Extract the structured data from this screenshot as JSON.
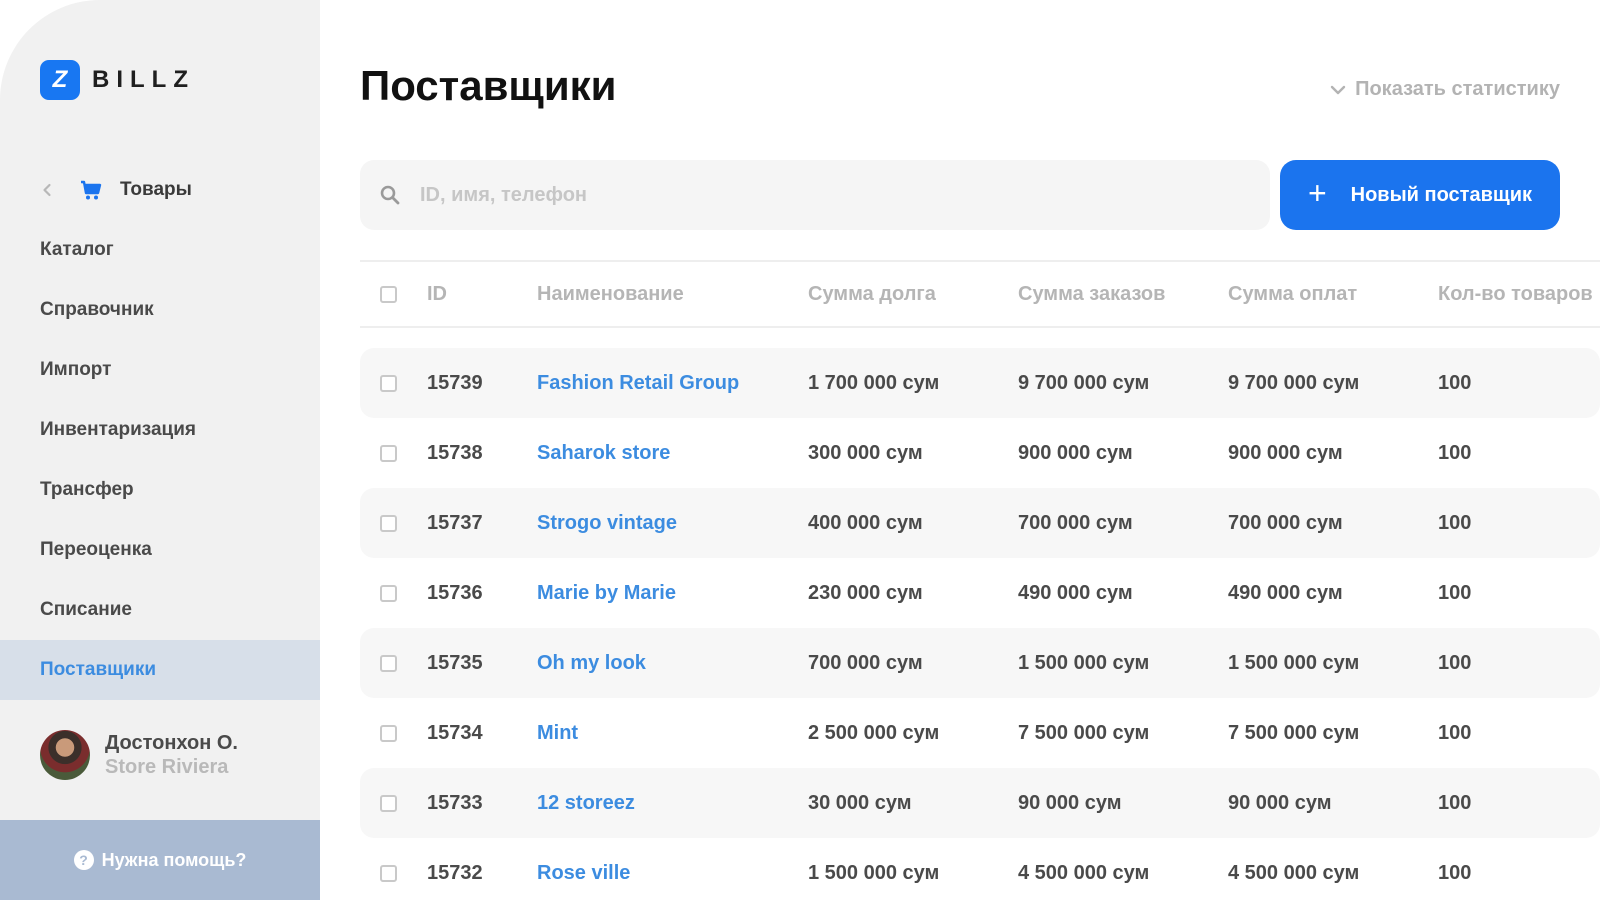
{
  "brand": {
    "mark": "Z",
    "name": "BILLZ"
  },
  "sidebar": {
    "back_item": {
      "label": "Товары"
    },
    "items": [
      {
        "label": "Каталог",
        "active": false
      },
      {
        "label": "Справочник",
        "active": false
      },
      {
        "label": "Импорт",
        "active": false
      },
      {
        "label": "Инвентаризация",
        "active": false
      },
      {
        "label": "Трансфер",
        "active": false
      },
      {
        "label": "Переоценка",
        "active": false
      },
      {
        "label": "Списание",
        "active": false
      },
      {
        "label": "Поставщики",
        "active": true
      }
    ],
    "user": {
      "name": "Достонхон О.",
      "store": "Store Riviera"
    },
    "help_label": "Нужна помощь?"
  },
  "header": {
    "title": "Поставщики",
    "stats_toggle": "Показать статистику"
  },
  "search": {
    "placeholder": "ID, имя, телефон",
    "value": ""
  },
  "new_button": {
    "label": "Новый поставщик"
  },
  "table": {
    "columns": [
      "ID",
      "Наименование",
      "Сумма долга",
      "Сумма заказов",
      "Сумма оплат",
      "Кол-во товаров"
    ],
    "rows": [
      {
        "id": "15739",
        "name": "Fashion Retail Group",
        "debt": "1 700 000 сум",
        "orders": "9 700 000 сум",
        "payments": "9 700 000 сум",
        "qty": "100"
      },
      {
        "id": "15738",
        "name": "Saharok store",
        "debt": "300 000 сум",
        "orders": "900 000 сум",
        "payments": "900 000 сум",
        "qty": "100"
      },
      {
        "id": "15737",
        "name": "Strogo vintage",
        "debt": "400 000 сум",
        "orders": "700 000 сум",
        "payments": "700 000 сум",
        "qty": "100"
      },
      {
        "id": "15736",
        "name": "Marie by Marie",
        "debt": "230 000 сум",
        "orders": "490 000 сум",
        "payments": "490 000 сум",
        "qty": "100"
      },
      {
        "id": "15735",
        "name": "Oh my look",
        "debt": "700 000 сум",
        "orders": "1 500 000 сум",
        "payments": "1 500 000 сум",
        "qty": "100"
      },
      {
        "id": "15734",
        "name": "Mint",
        "debt": "2 500 000 сум",
        "orders": "7 500 000 сум",
        "payments": "7 500 000 сум",
        "qty": "100"
      },
      {
        "id": "15733",
        "name": "12 storeez",
        "debt": "30 000 сум",
        "orders": "90 000 сум",
        "payments": "90 000 сум",
        "qty": "100"
      },
      {
        "id": "15732",
        "name": "Rose ville",
        "debt": "1 500 000 сум",
        "orders": "4 500 000 сум",
        "payments": "4 500 000 сум",
        "qty": "100"
      }
    ]
  },
  "colors": {
    "accent": "#1b74ee",
    "link": "#3c8ce0",
    "active_nav_bg": "#d7dfe9",
    "help_bg": "#a9bad2",
    "sidebar_bg": "#f1f1f1"
  }
}
